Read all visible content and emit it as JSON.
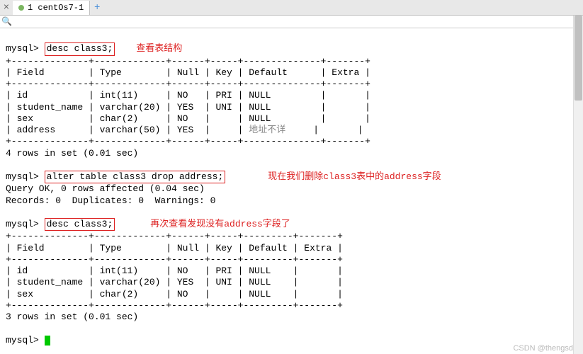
{
  "tab": {
    "title": "1 centOs7-1"
  },
  "annotations": {
    "a1": "查看表结构",
    "a2": "现在我们删除class3表中的address字段",
    "a3": "再次查看发现没有address字段了"
  },
  "commands": {
    "prompt": "mysql>",
    "desc1": "desc class3;",
    "alter": "alter table class3 drop address;",
    "desc2": "desc class3;"
  },
  "table1": {
    "border_top": "+--------------+-------------+------+-----+--------------+-------+",
    "header": "| Field        | Type        | Null | Key | Default      | Extra |",
    "border_mid": "+--------------+-------------+------+-----+--------------+-------+",
    "row1": "| id           | int(11)     | NO   | PRI | NULL         |       |",
    "row2": "| student_name | varchar(20) | YES  | UNI | NULL         |       |",
    "row3": "| sex          | char(2)     | NO   |     | NULL         |       |",
    "row4a": "| address      | varchar(50) | YES  |     | ",
    "row4_default": "地址不详",
    "row4b": "     |       |",
    "border_bot": "+--------------+-------------+------+-----+--------------+-------+",
    "footer": "4 rows in set (0.01 sec)"
  },
  "alter_output": {
    "line1": "Query OK, 0 rows affected (0.04 sec)",
    "line2": "Records: 0  Duplicates: 0  Warnings: 0"
  },
  "table2": {
    "border_top": "+--------------+-------------+------+-----+---------+-------+",
    "header": "| Field        | Type        | Null | Key | Default | Extra |",
    "border_mid": "+--------------+-------------+------+-----+---------+-------+",
    "row1": "| id           | int(11)     | NO   | PRI | NULL    |       |",
    "row2": "| student_name | varchar(20) | YES  | UNI | NULL    |       |",
    "row3": "| sex          | char(2)     | NO   |     | NULL    |       |",
    "border_bot": "+--------------+-------------+------+-----+---------+-------+",
    "footer": "3 rows in set (0.01 sec)"
  },
  "watermark": "CSDN @thengsd"
}
